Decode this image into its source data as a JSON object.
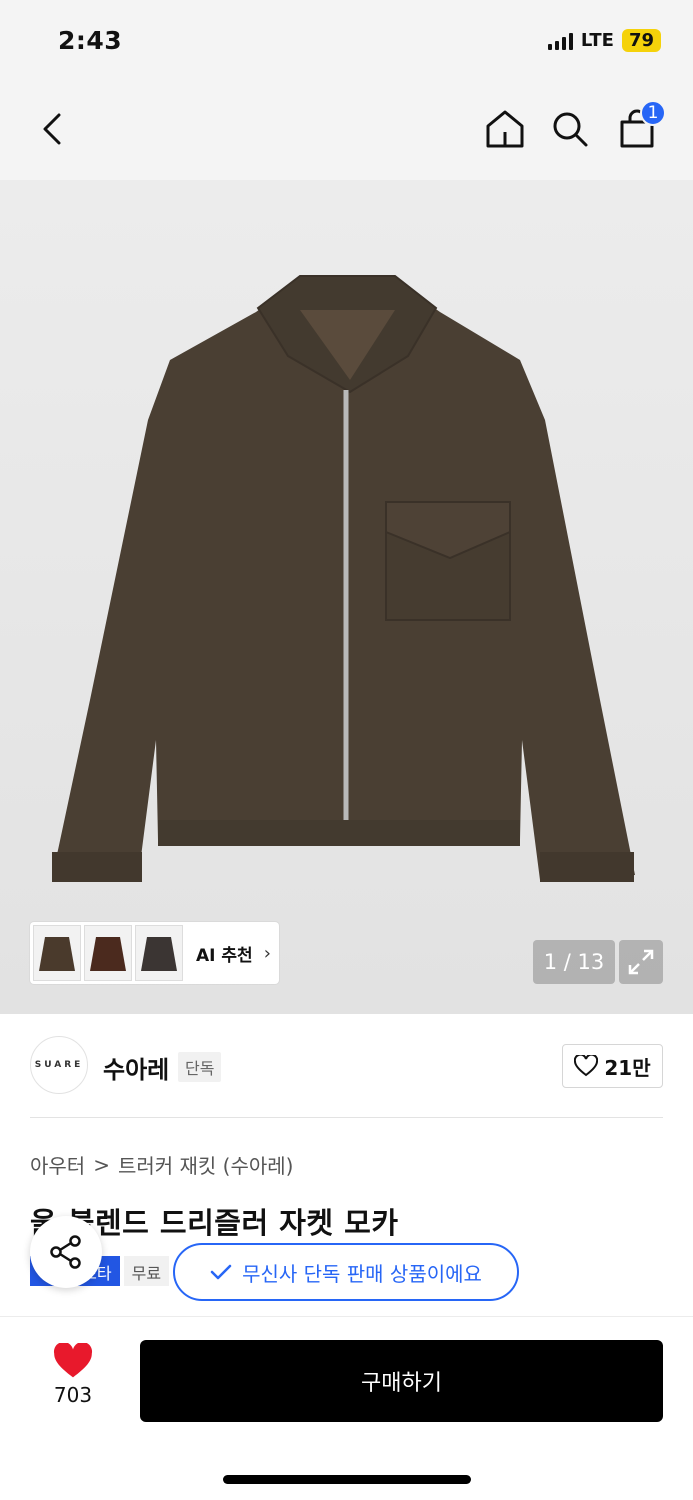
{
  "status_bar": {
    "time": "2:43",
    "network": "LTE",
    "battery": "79"
  },
  "header": {
    "cart_count": "1"
  },
  "gallery": {
    "ai_recommend_label": "AI 추천",
    "page_indicator": "1 / 13"
  },
  "brand": {
    "logo_text": "SUARE",
    "name": "수아레",
    "tag": "단독",
    "like_count": "21만"
  },
  "breadcrumb": {
    "category": "아우터",
    "separator": ">",
    "sub_category": "트러커 재킷 (수아레)"
  },
  "product": {
    "title": "울 블렌드 드리즐러 자켓 모카"
  },
  "badges": {
    "blue": "스타",
    "gray": "무료"
  },
  "toast": {
    "text": "무신사 단독 판매 상품이에요"
  },
  "bottom": {
    "wish_count": "703",
    "buy_label": "구매하기"
  },
  "colors": {
    "accent": "#2766f6",
    "heart": "#e8192c",
    "jacket": "#4a3f33"
  }
}
